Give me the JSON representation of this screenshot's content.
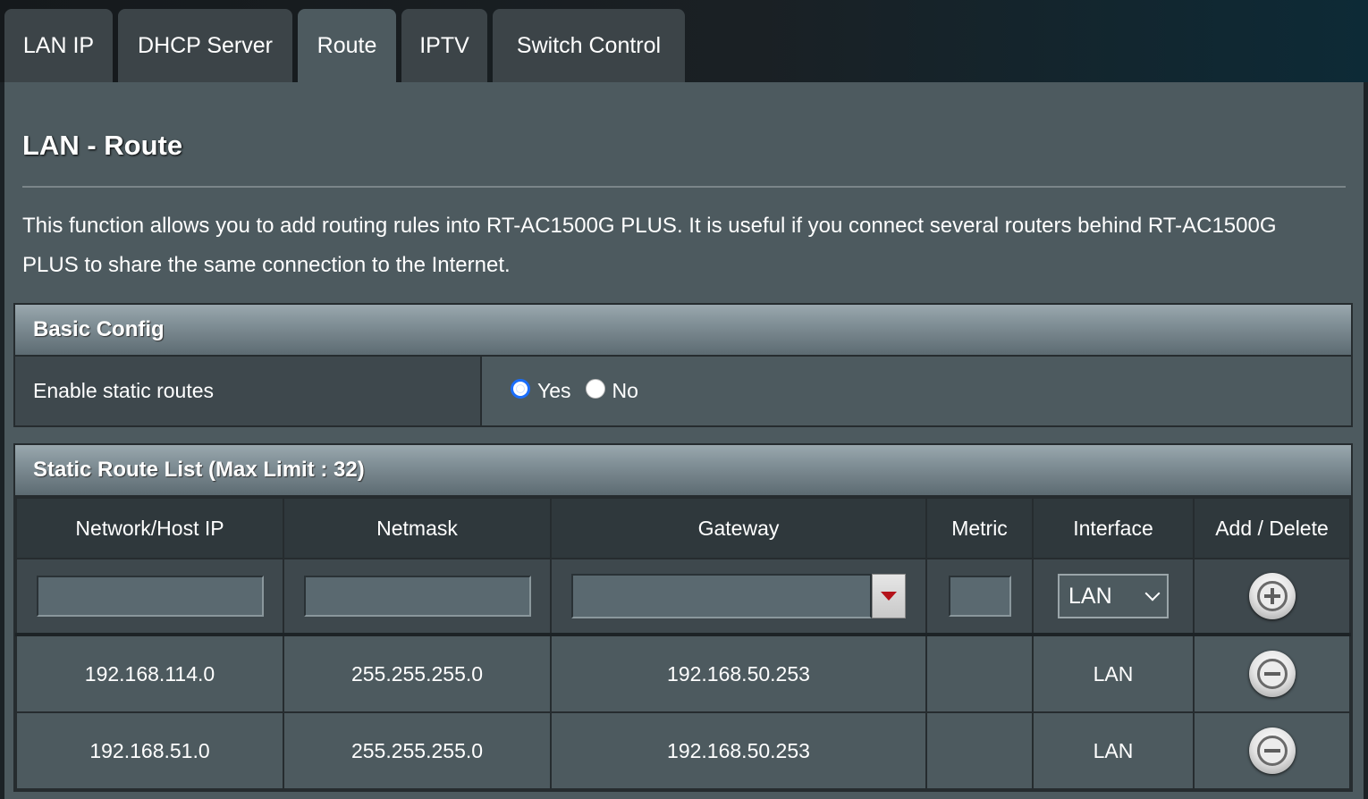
{
  "tabs": [
    {
      "label": "LAN IP"
    },
    {
      "label": "DHCP Server"
    },
    {
      "label": "Route",
      "active": true
    },
    {
      "label": "IPTV"
    },
    {
      "label": "Switch Control"
    }
  ],
  "page": {
    "title": "LAN - Route",
    "description": "This function allows you to add routing rules into RT-AC1500G PLUS. It is useful if you connect several routers behind RT-AC1500G PLUS to share the same connection to the Internet."
  },
  "basic_config": {
    "header": "Basic Config",
    "enable_label": "Enable static routes",
    "yes_label": "Yes",
    "no_label": "No",
    "selected": "Yes"
  },
  "route_list": {
    "header": "Static Route List (Max Limit : 32)",
    "columns": [
      "Network/Host IP",
      "Netmask",
      "Gateway",
      "Metric",
      "Interface",
      "Add / Delete"
    ],
    "input_row": {
      "network": "",
      "netmask": "",
      "gateway": "",
      "metric": "",
      "interface": "LAN"
    },
    "rows": [
      {
        "network": "192.168.114.0",
        "netmask": "255.255.255.0",
        "gateway": "192.168.50.253",
        "metric": "",
        "interface": "LAN"
      },
      {
        "network": "192.168.51.0",
        "netmask": "255.255.255.0",
        "gateway": "192.168.50.253",
        "metric": "",
        "interface": "LAN"
      }
    ]
  },
  "icons": {
    "add": "plus-circle-icon",
    "delete": "minus-circle-icon",
    "gateway_dropdown": "red-triangle-down-icon",
    "select_arrow": "chevron-down-icon"
  },
  "colors": {
    "panel": "#4d5a5f",
    "header_gradient_top": "#9aa8ae",
    "radio_selected": "#1a6dfa",
    "dropdown_arrow": "#b4121a"
  }
}
